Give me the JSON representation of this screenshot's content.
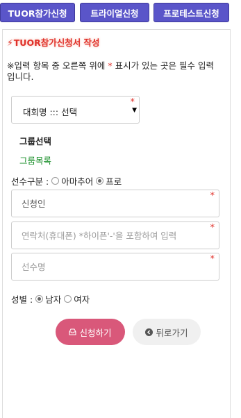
{
  "nav": {
    "tuor_apply": "TUOR참가신청",
    "trial_apply": "트라이얼신청",
    "pro_test_apply": "프로테스트신청"
  },
  "form": {
    "title": "TUOR참가신청서 작성",
    "notice_prefix": "※입력 항목 중 오른쪽 위에 ",
    "notice_star": "*",
    "notice_suffix": " 표시가 있는 곳은 필수 입력입니다.",
    "required_mark": "*",
    "competition_select": {
      "selected": "대회명 ::: 선택"
    },
    "group_select_label": "그룹선택",
    "group_list_link": "그룹목록",
    "player_type": {
      "label": "선수구분 :",
      "options": [
        "아마추어",
        "프로"
      ],
      "selected": "프로"
    },
    "applicant": {
      "value": "",
      "placeholder": "신청인"
    },
    "contact": {
      "value": "",
      "placeholder": "연락처(휴대폰) *하이픈'-'을 포함하여 입력"
    },
    "player_name": {
      "value": "",
      "placeholder": "선수명"
    },
    "gender": {
      "label": "성별 :",
      "options": [
        "남자",
        "여자"
      ],
      "selected": "남자"
    },
    "apply_button": "신청하기",
    "back_button": "뒤로가기"
  },
  "colors": {
    "nav_bg": "#5a55c9",
    "title_red": "#e0302a",
    "group_green": "#1a8f2a",
    "apply_pink": "#d9587a",
    "back_gray": "#f0f0f0"
  },
  "icons": {
    "title": "lightning-bolt-icon",
    "apply": "inbox-icon",
    "back": "circle-arrow-left-icon"
  }
}
